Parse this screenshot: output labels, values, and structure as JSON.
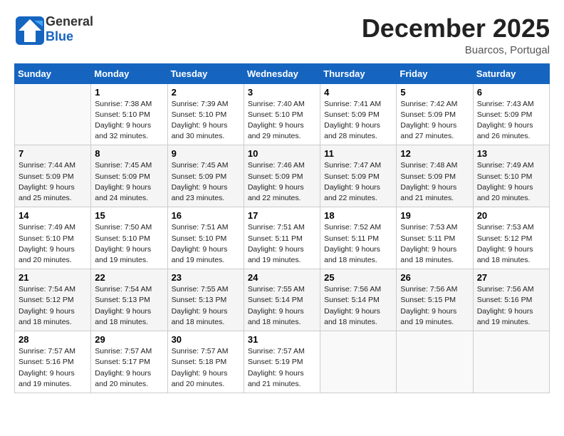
{
  "header": {
    "logo_general": "General",
    "logo_blue": "Blue",
    "month": "December 2025",
    "location": "Buarcos, Portugal"
  },
  "weekdays": [
    "Sunday",
    "Monday",
    "Tuesday",
    "Wednesday",
    "Thursday",
    "Friday",
    "Saturday"
  ],
  "weeks": [
    [
      {
        "day": "",
        "info": ""
      },
      {
        "day": "1",
        "info": "Sunrise: 7:38 AM\nSunset: 5:10 PM\nDaylight: 9 hours\nand 32 minutes."
      },
      {
        "day": "2",
        "info": "Sunrise: 7:39 AM\nSunset: 5:10 PM\nDaylight: 9 hours\nand 30 minutes."
      },
      {
        "day": "3",
        "info": "Sunrise: 7:40 AM\nSunset: 5:10 PM\nDaylight: 9 hours\nand 29 minutes."
      },
      {
        "day": "4",
        "info": "Sunrise: 7:41 AM\nSunset: 5:09 PM\nDaylight: 9 hours\nand 28 minutes."
      },
      {
        "day": "5",
        "info": "Sunrise: 7:42 AM\nSunset: 5:09 PM\nDaylight: 9 hours\nand 27 minutes."
      },
      {
        "day": "6",
        "info": "Sunrise: 7:43 AM\nSunset: 5:09 PM\nDaylight: 9 hours\nand 26 minutes."
      }
    ],
    [
      {
        "day": "7",
        "info": "Sunrise: 7:44 AM\nSunset: 5:09 PM\nDaylight: 9 hours\nand 25 minutes."
      },
      {
        "day": "8",
        "info": "Sunrise: 7:45 AM\nSunset: 5:09 PM\nDaylight: 9 hours\nand 24 minutes."
      },
      {
        "day": "9",
        "info": "Sunrise: 7:45 AM\nSunset: 5:09 PM\nDaylight: 9 hours\nand 23 minutes."
      },
      {
        "day": "10",
        "info": "Sunrise: 7:46 AM\nSunset: 5:09 PM\nDaylight: 9 hours\nand 22 minutes."
      },
      {
        "day": "11",
        "info": "Sunrise: 7:47 AM\nSunset: 5:09 PM\nDaylight: 9 hours\nand 22 minutes."
      },
      {
        "day": "12",
        "info": "Sunrise: 7:48 AM\nSunset: 5:09 PM\nDaylight: 9 hours\nand 21 minutes."
      },
      {
        "day": "13",
        "info": "Sunrise: 7:49 AM\nSunset: 5:10 PM\nDaylight: 9 hours\nand 20 minutes."
      }
    ],
    [
      {
        "day": "14",
        "info": "Sunrise: 7:49 AM\nSunset: 5:10 PM\nDaylight: 9 hours\nand 20 minutes."
      },
      {
        "day": "15",
        "info": "Sunrise: 7:50 AM\nSunset: 5:10 PM\nDaylight: 9 hours\nand 19 minutes."
      },
      {
        "day": "16",
        "info": "Sunrise: 7:51 AM\nSunset: 5:10 PM\nDaylight: 9 hours\nand 19 minutes."
      },
      {
        "day": "17",
        "info": "Sunrise: 7:51 AM\nSunset: 5:11 PM\nDaylight: 9 hours\nand 19 minutes."
      },
      {
        "day": "18",
        "info": "Sunrise: 7:52 AM\nSunset: 5:11 PM\nDaylight: 9 hours\nand 18 minutes."
      },
      {
        "day": "19",
        "info": "Sunrise: 7:53 AM\nSunset: 5:11 PM\nDaylight: 9 hours\nand 18 minutes."
      },
      {
        "day": "20",
        "info": "Sunrise: 7:53 AM\nSunset: 5:12 PM\nDaylight: 9 hours\nand 18 minutes."
      }
    ],
    [
      {
        "day": "21",
        "info": "Sunrise: 7:54 AM\nSunset: 5:12 PM\nDaylight: 9 hours\nand 18 minutes."
      },
      {
        "day": "22",
        "info": "Sunrise: 7:54 AM\nSunset: 5:13 PM\nDaylight: 9 hours\nand 18 minutes."
      },
      {
        "day": "23",
        "info": "Sunrise: 7:55 AM\nSunset: 5:13 PM\nDaylight: 9 hours\nand 18 minutes."
      },
      {
        "day": "24",
        "info": "Sunrise: 7:55 AM\nSunset: 5:14 PM\nDaylight: 9 hours\nand 18 minutes."
      },
      {
        "day": "25",
        "info": "Sunrise: 7:56 AM\nSunset: 5:14 PM\nDaylight: 9 hours\nand 18 minutes."
      },
      {
        "day": "26",
        "info": "Sunrise: 7:56 AM\nSunset: 5:15 PM\nDaylight: 9 hours\nand 19 minutes."
      },
      {
        "day": "27",
        "info": "Sunrise: 7:56 AM\nSunset: 5:16 PM\nDaylight: 9 hours\nand 19 minutes."
      }
    ],
    [
      {
        "day": "28",
        "info": "Sunrise: 7:57 AM\nSunset: 5:16 PM\nDaylight: 9 hours\nand 19 minutes."
      },
      {
        "day": "29",
        "info": "Sunrise: 7:57 AM\nSunset: 5:17 PM\nDaylight: 9 hours\nand 20 minutes."
      },
      {
        "day": "30",
        "info": "Sunrise: 7:57 AM\nSunset: 5:18 PM\nDaylight: 9 hours\nand 20 minutes."
      },
      {
        "day": "31",
        "info": "Sunrise: 7:57 AM\nSunset: 5:19 PM\nDaylight: 9 hours\nand 21 minutes."
      },
      {
        "day": "",
        "info": ""
      },
      {
        "day": "",
        "info": ""
      },
      {
        "day": "",
        "info": ""
      }
    ]
  ]
}
